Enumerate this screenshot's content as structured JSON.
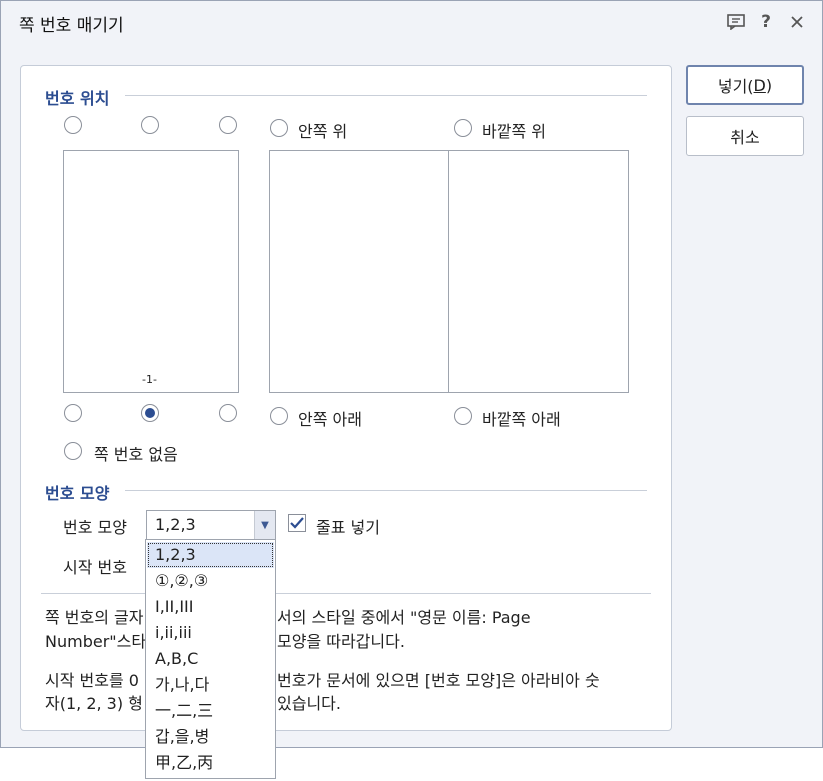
{
  "window": {
    "title": "쪽 번호 매기기",
    "icons": {
      "comment": "comment-icon",
      "help": "help-icon",
      "close": "close-icon"
    }
  },
  "buttons": {
    "insert": "넣기(D)",
    "insert_mnemonic": "D",
    "cancel": "취소"
  },
  "position": {
    "section_title": "번호 위치",
    "inner_top": "안쪽 위",
    "outer_top": "바깥쪽 위",
    "inner_bottom": "안쪽 아래",
    "outer_bottom": "바깥쪽 아래",
    "no_number": "쪽 번호 없음",
    "page_preview_number": "-1-",
    "selected": "bottom-center"
  },
  "format": {
    "section_title": "번호 모양",
    "shape_label": "번호 모양",
    "shape_value": "1,2,3",
    "start_label": "시작 번호",
    "punctuation_label": "줄표 넣기",
    "punctuation_checked": true,
    "options": [
      "1,2,3",
      "①,②,③",
      "I,II,III",
      "i,ii,iii",
      "A,B,C",
      "가,나,다",
      "一,二,三",
      "갑,을,병",
      "甲,乙,丙"
    ]
  },
  "hint": {
    "line1_a": "쪽 번호의 글자",
    "line1_b": "서의 스타일 중에서 \"영문 이름: Page",
    "line2_a": "Number\"스타",
    "line2_b": "모양을 따라갑니다.",
    "line3_a": "시작 번호를 0",
    "line3_b": "번호가 문서에 있으면 [번호 모양]은 아라비아 숫",
    "line4_a": "자(1, 2, 3) 형",
    "line4_b": "있습니다."
  },
  "colors": {
    "accent": "#2c4d91",
    "dialog_bg": "#f1f3f8",
    "border": "#9aa3b5"
  }
}
